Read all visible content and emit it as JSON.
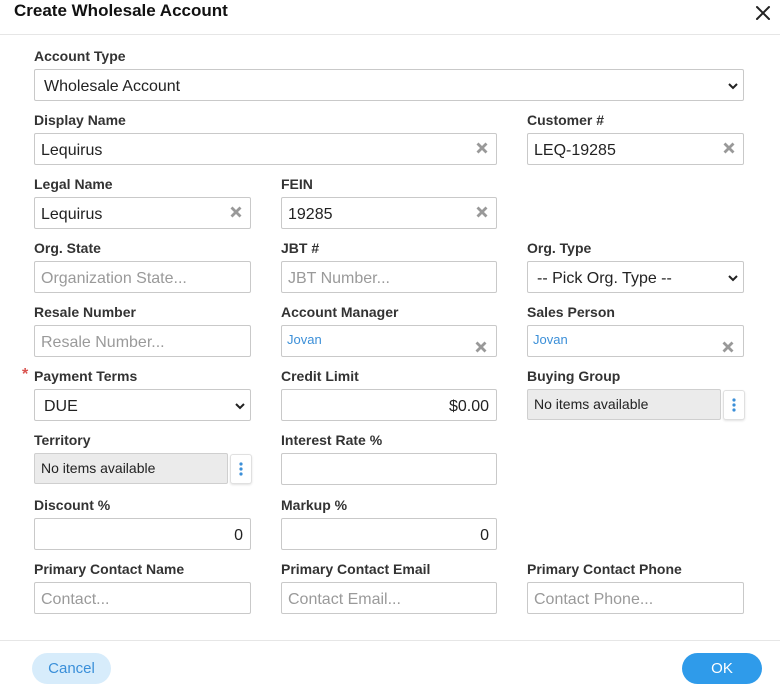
{
  "dialog": {
    "title": "Create Wholesale Account",
    "close_icon": "close-icon"
  },
  "form": {
    "account_type": {
      "label": "Account Type",
      "value": "Wholesale Account"
    },
    "display_name": {
      "label": "Display Name",
      "value": "Lequirus"
    },
    "customer_number": {
      "label": "Customer #",
      "value": "LEQ-19285"
    },
    "legal_name": {
      "label": "Legal Name",
      "value": "Lequirus"
    },
    "fein": {
      "label": "FEIN",
      "value": "19285"
    },
    "org_state": {
      "label": "Org. State",
      "placeholder": "Organization State..."
    },
    "jbt_number": {
      "label": "JBT #",
      "placeholder": "JBT Number..."
    },
    "org_type": {
      "label": "Org. Type",
      "value": "-- Pick Org. Type --"
    },
    "resale_number": {
      "label": "Resale Number",
      "placeholder": "Resale Number..."
    },
    "account_manager": {
      "label": "Account Manager",
      "value": "Jovan"
    },
    "sales_person": {
      "label": "Sales Person",
      "value": "Jovan"
    },
    "payment_terms": {
      "label": "Payment Terms",
      "value": "DUE",
      "required_marker": "*"
    },
    "credit_limit": {
      "label": "Credit Limit",
      "value": "$0.00"
    },
    "buying_group": {
      "label": "Buying Group",
      "value": "No items available"
    },
    "territory": {
      "label": "Territory",
      "value": "No items available"
    },
    "interest_rate": {
      "label": "Interest Rate %",
      "value": ""
    },
    "discount": {
      "label": "Discount %",
      "value": "0"
    },
    "markup": {
      "label": "Markup %",
      "value": "0"
    },
    "primary_contact_name": {
      "label": "Primary Contact Name",
      "placeholder": "Contact..."
    },
    "primary_contact_email": {
      "label": "Primary Contact Email",
      "placeholder": "Contact Email..."
    },
    "primary_contact_phone": {
      "label": "Primary Contact Phone",
      "placeholder": "Contact Phone..."
    }
  },
  "footer": {
    "cancel_label": "Cancel",
    "ok_label": "OK"
  },
  "colors": {
    "primary": "#2f9bea",
    "primary_light": "#d7ecfb",
    "link_blue": "#3b8fd8",
    "required": "#d9534f"
  },
  "icons": {
    "clear": "clear-x-icon",
    "dropdown": "chevron-down-icon",
    "more": "vertical-dots-icon"
  }
}
